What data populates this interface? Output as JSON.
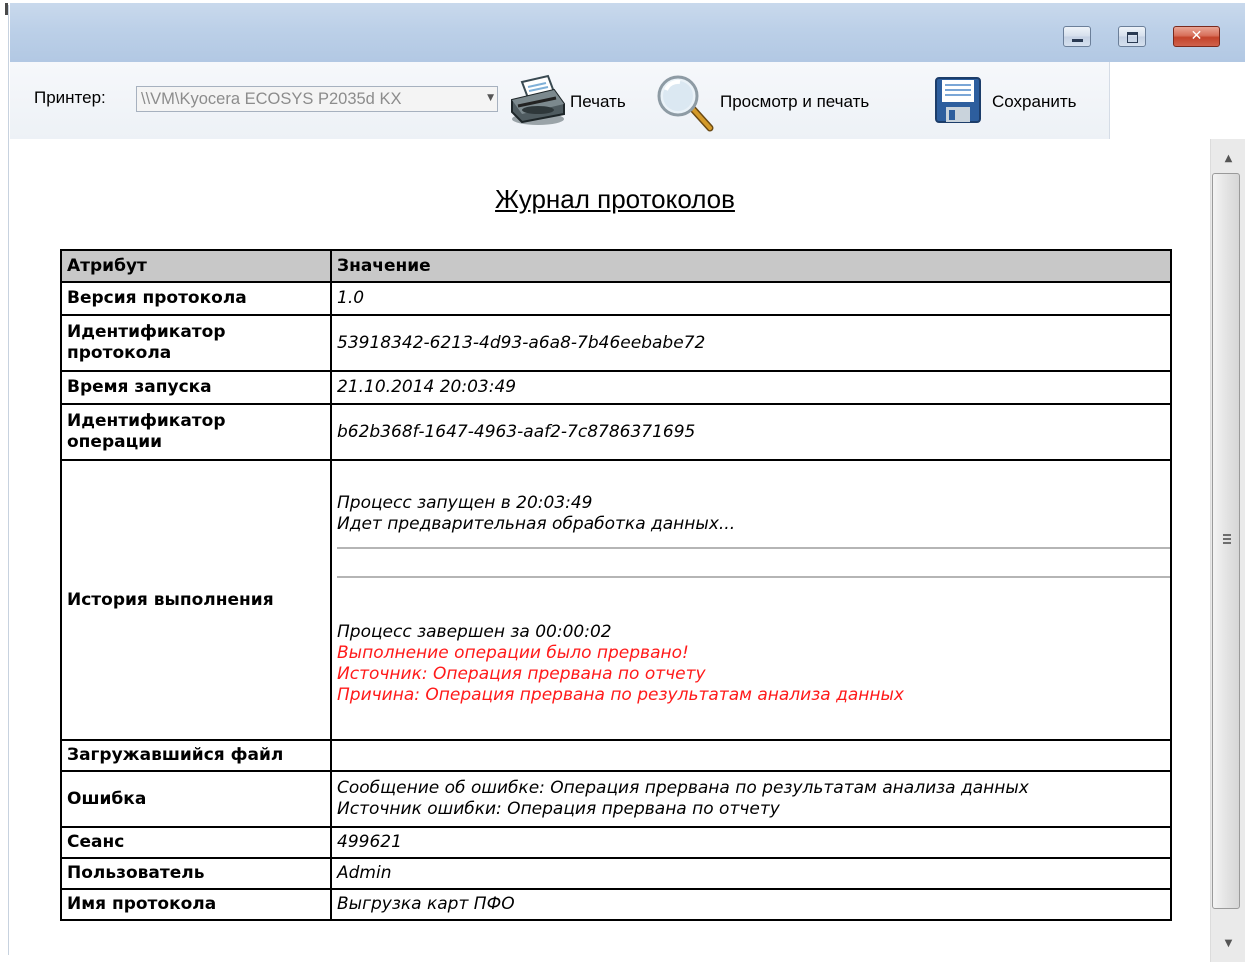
{
  "toolbar": {
    "printer_label": "Принтер:",
    "printer_value": "\\\\VM\\Kyocera ECOSYS P2035d KX",
    "print_label": "Печать",
    "preview_label": "Просмотр и печать",
    "save_label": "Сохранить"
  },
  "report": {
    "title": "Журнал протоколов",
    "header_attr": "Атрибут",
    "header_value": "Значение",
    "rows": [
      {
        "attr": "Версия протокола",
        "value": "1.0"
      },
      {
        "attr": "Идентификатор протокола",
        "value": "53918342-6213-4d93-a6a8-7b46eebabe72"
      },
      {
        "attr": "Время запуска",
        "value": "21.10.2014 20:03:49"
      },
      {
        "attr": "Идентификатор операции",
        "value": "b62b368f-1647-4963-aaf2-7c8786371695"
      },
      {
        "attr": "История выполнения",
        "lines": [
          "Процесс запущен в 20:03:49",
          "Идет предварительная обработка данных...",
          "Процесс завершен за 00:00:02",
          "Выполнение операции было прервано!",
          "Источник: Операция прервана по отчету",
          "Причина: Операция прервана по результатам анализа данных"
        ]
      },
      {
        "attr": "Загружавшийся файл",
        "value": ""
      },
      {
        "attr": "Ошибка",
        "lines": [
          "Сообщение об ошибке: Операция прервана по результатам анализа данных",
          "Источник ошибки: Операция прервана по отчету"
        ]
      },
      {
        "attr": "Сеанс",
        "value": "499621"
      },
      {
        "attr": "Пользователь",
        "value": "Admin"
      },
      {
        "attr": "Имя протокола",
        "value": "Выгрузка карт ПФО"
      }
    ]
  },
  "colors": {
    "error_text": "#ff1a1a",
    "header_bg": "#c8c8c8",
    "titlebar": "#bcd0e8"
  }
}
